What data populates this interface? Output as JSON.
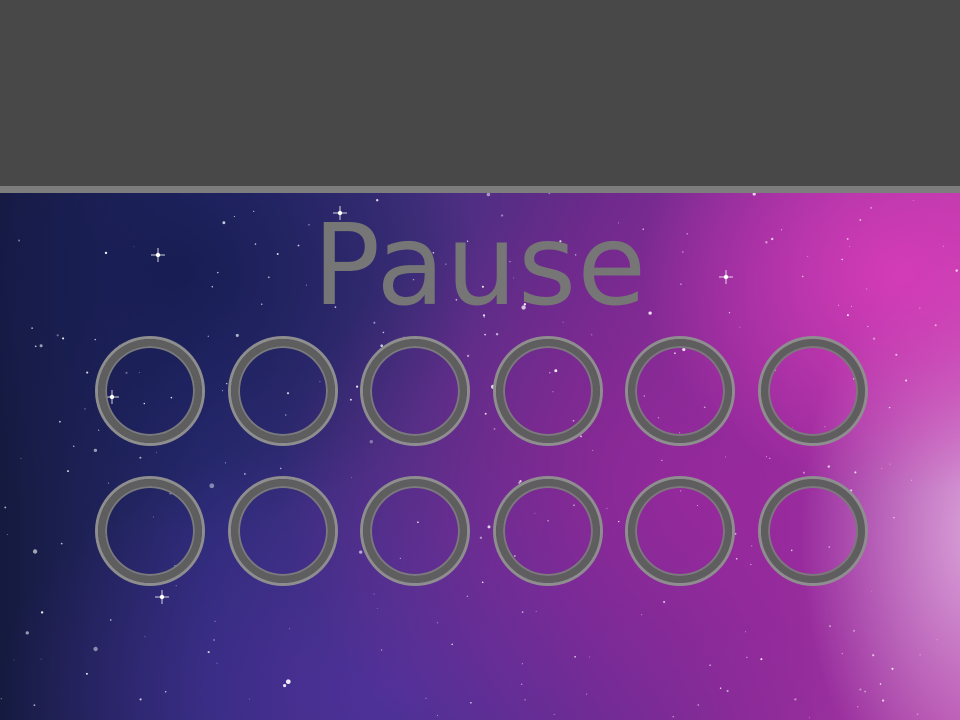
{
  "screen": {
    "title": "Pause"
  },
  "slots": {
    "rows": 2,
    "columns": 6,
    "items": [
      {
        "row": 1,
        "column": 1,
        "state": "empty"
      },
      {
        "row": 1,
        "column": 2,
        "state": "empty"
      },
      {
        "row": 1,
        "column": 3,
        "state": "empty"
      },
      {
        "row": 1,
        "column": 4,
        "state": "empty"
      },
      {
        "row": 1,
        "column": 5,
        "state": "empty"
      },
      {
        "row": 1,
        "column": 6,
        "state": "empty"
      },
      {
        "row": 2,
        "column": 1,
        "state": "empty"
      },
      {
        "row": 2,
        "column": 2,
        "state": "empty"
      },
      {
        "row": 2,
        "column": 3,
        "state": "empty"
      },
      {
        "row": 2,
        "column": 4,
        "state": "empty"
      },
      {
        "row": 2,
        "column": 5,
        "state": "empty"
      },
      {
        "row": 2,
        "column": 6,
        "state": "empty"
      }
    ]
  },
  "colors": {
    "top_panel": "#484848",
    "divider": "#7d7d7d",
    "title_text": "#767676",
    "slot_ring": "#5e5e5e",
    "slot_ring_highlight": "#8e8e8e"
  }
}
